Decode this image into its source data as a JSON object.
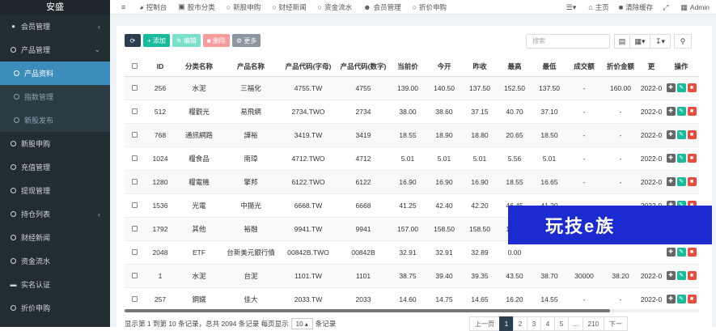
{
  "brand": "安盛",
  "sidebar": {
    "items": [
      {
        "label": "会员管理",
        "icon": "user-circle-icon",
        "arrow": "‹"
      },
      {
        "label": "产品管理",
        "icon": "circle-icon",
        "arrow": "⌄"
      },
      {
        "label": "产品资料",
        "icon": "circle-icon"
      },
      {
        "label": "指数管理",
        "icon": "circle-icon"
      },
      {
        "label": "新股发布",
        "icon": "circle-icon"
      },
      {
        "label": "新股申购",
        "icon": "circle-icon"
      },
      {
        "label": "充值管理",
        "icon": "circle-icon"
      },
      {
        "label": "提现管理",
        "icon": "circle-icon"
      },
      {
        "label": "持仓列表",
        "icon": "circle-icon",
        "arrow": "‹"
      },
      {
        "label": "财经新闻",
        "icon": "circle-icon"
      },
      {
        "label": "资金流水",
        "icon": "circle-icon"
      },
      {
        "label": "实名认证",
        "icon": "id-card-icon"
      },
      {
        "label": "折价申购",
        "icon": "circle-icon"
      }
    ]
  },
  "topbar": {
    "menu_icon": "≡",
    "items": [
      "控制台",
      "股市分类",
      "新股申购",
      "财经新闻",
      "资金流水",
      "会员管理",
      "折价申购"
    ],
    "right": {
      "home": "主页",
      "clear_cache": "清除缓存",
      "admin": "Admin"
    }
  },
  "toolbar": {
    "add": "添加",
    "edit": "编辑",
    "delete": "删除",
    "more": "更多"
  },
  "search": {
    "placeholder": "搜索"
  },
  "table": {
    "headers": [
      "ID",
      "分类名称",
      "产品名称",
      "产品代码(字母)",
      "产品代码(数字)",
      "当前价",
      "今开",
      "昨收",
      "最高",
      "最低",
      "成交额",
      "折价金额",
      "更",
      "操作"
    ],
    "rows": [
      [
        "256",
        "水泥",
        "三福化",
        "4755.TW",
        "4755",
        "139.00",
        "140.50",
        "137.50",
        "152.50",
        "137.50",
        "-",
        "160.00",
        "2022-0"
      ],
      [
        "512",
        "糧觀光",
        "易飛網",
        "2734.TWO",
        "2734",
        "38.00",
        "38.60",
        "37.15",
        "40.70",
        "37.10",
        "-",
        "-",
        "2022-0"
      ],
      [
        "768",
        "通訊網路",
        "譁裕",
        "3419.TW",
        "3419",
        "18.55",
        "18.90",
        "18.80",
        "20.65",
        "18.50",
        "-",
        "-",
        "2022-0"
      ],
      [
        "1024",
        "糧食品",
        "南璋",
        "4712.TWO",
        "4712",
        "5.01",
        "5.01",
        "5.01",
        "5.56",
        "5.01",
        "-",
        "-",
        "2022-0"
      ],
      [
        "1280",
        "糧電機",
        "擎邦",
        "6122.TWO",
        "6122",
        "16.90",
        "16.90",
        "16.90",
        "18.55",
        "16.65",
        "-",
        "-",
        "2022-0"
      ],
      [
        "1536",
        "光電",
        "中揚光",
        "6668.TW",
        "6668",
        "41.25",
        "42.40",
        "42.20",
        "46.45",
        "41.20",
        "-",
        "-",
        "2022-0"
      ],
      [
        "1792",
        "其他",
        "裕融",
        "9941.TW",
        "9941",
        "157.00",
        "158.50",
        "158.50",
        "174.0",
        "",
        "",
        "",
        ""
      ],
      [
        "2048",
        "ETF",
        "台新美元銀行債",
        "00842B.TWO",
        "00842B",
        "32.91",
        "32.91",
        "32.89",
        "0.00",
        "",
        "",
        "",
        ""
      ],
      [
        "1",
        "水泥",
        "台泥",
        "1101.TW",
        "1101",
        "38.75",
        "39.40",
        "39.35",
        "43.50",
        "38.70",
        "30000",
        "38.20",
        "2022-0"
      ],
      [
        "257",
        "鋼鐵",
        "佳大",
        "2033.TW",
        "2033",
        "14.60",
        "14.75",
        "14.65",
        "16.20",
        "14.55",
        "-",
        "-",
        "2022-0"
      ]
    ]
  },
  "footer": {
    "left": "显示第 1 到第 10 条记录，总共 2094 条记录 每页显示",
    "page_size": "10",
    "right": "条记录"
  },
  "pager": [
    "上一页",
    "1",
    "2",
    "3",
    "4",
    "5",
    "...",
    "210",
    "下一"
  ],
  "watermark": "玩技e族"
}
